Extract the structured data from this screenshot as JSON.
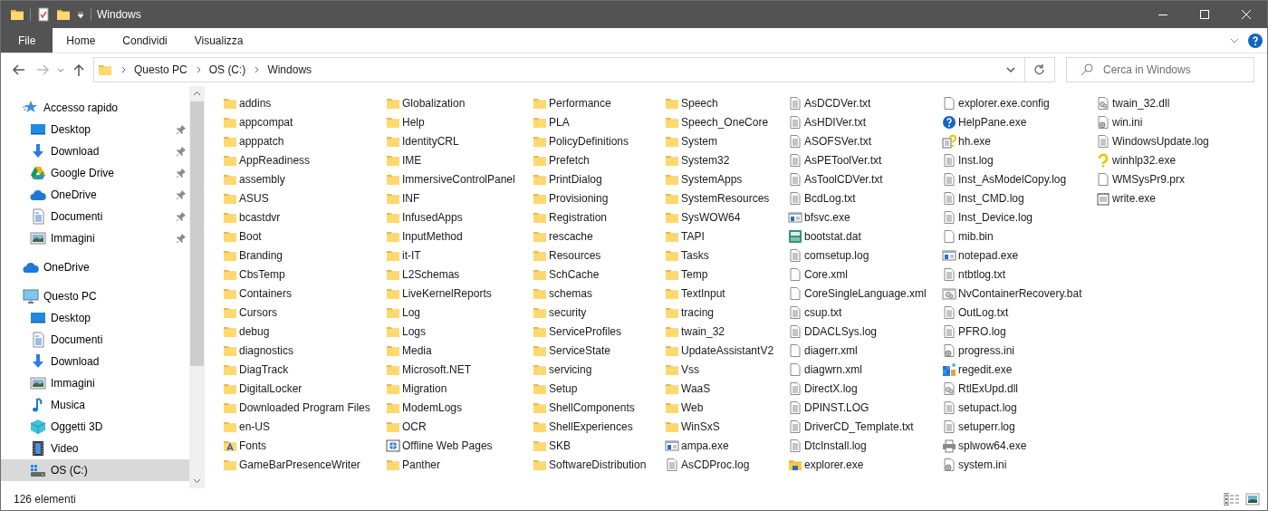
{
  "window": {
    "title": "Windows"
  },
  "ribbon": {
    "file_tab": "File",
    "tabs": [
      "Home",
      "Condividi",
      "Visualizza"
    ]
  },
  "address": {
    "path": [
      "Questo PC",
      "OS (C:)",
      "Windows"
    ]
  },
  "search": {
    "placeholder": "Cerca in Windows"
  },
  "sidebar": {
    "items": [
      {
        "label": "Accesso rapido",
        "kind": "star",
        "pinned": false,
        "selected": false,
        "children": [
          {
            "label": "Desktop",
            "kind": "desktop",
            "pinned": true,
            "selected": false
          },
          {
            "label": "Download",
            "kind": "download",
            "pinned": true,
            "selected": false
          },
          {
            "label": "Google Drive",
            "kind": "gdrive",
            "pinned": true,
            "selected": false
          },
          {
            "label": "OneDrive",
            "kind": "cloud",
            "pinned": true,
            "selected": false
          },
          {
            "label": "Documenti",
            "kind": "documents",
            "pinned": true,
            "selected": false
          },
          {
            "label": "Immagini",
            "kind": "pictures",
            "pinned": true,
            "selected": false
          }
        ]
      },
      {
        "label": "OneDrive",
        "kind": "cloud",
        "pinned": false,
        "selected": false
      },
      {
        "label": "Questo PC",
        "kind": "pc",
        "pinned": false,
        "selected": false,
        "children": [
          {
            "label": "Desktop",
            "kind": "desktop",
            "pinned": false,
            "selected": false
          },
          {
            "label": "Documenti",
            "kind": "documents",
            "pinned": false,
            "selected": false
          },
          {
            "label": "Download",
            "kind": "download",
            "pinned": false,
            "selected": false
          },
          {
            "label": "Immagini",
            "kind": "pictures",
            "pinned": false,
            "selected": false
          },
          {
            "label": "Musica",
            "kind": "music",
            "pinned": false,
            "selected": false
          },
          {
            "label": "Oggetti 3D",
            "kind": "objects3d",
            "pinned": false,
            "selected": false
          },
          {
            "label": "Video",
            "kind": "video",
            "pinned": false,
            "selected": false
          },
          {
            "label": "OS (C:)",
            "kind": "drive",
            "pinned": false,
            "selected": true
          }
        ]
      }
    ]
  },
  "files": [
    {
      "name": "addins",
      "kind": "folder"
    },
    {
      "name": "appcompat",
      "kind": "folder"
    },
    {
      "name": "apppatch",
      "kind": "folder"
    },
    {
      "name": "AppReadiness",
      "kind": "folder"
    },
    {
      "name": "assembly",
      "kind": "folder"
    },
    {
      "name": "ASUS",
      "kind": "folder"
    },
    {
      "name": "bcastdvr",
      "kind": "folder"
    },
    {
      "name": "Boot",
      "kind": "folder"
    },
    {
      "name": "Branding",
      "kind": "folder"
    },
    {
      "name": "CbsTemp",
      "kind": "folder"
    },
    {
      "name": "Containers",
      "kind": "folder"
    },
    {
      "name": "Cursors",
      "kind": "folder"
    },
    {
      "name": "debug",
      "kind": "folder"
    },
    {
      "name": "diagnostics",
      "kind": "folder"
    },
    {
      "name": "DiagTrack",
      "kind": "folder"
    },
    {
      "name": "DigitalLocker",
      "kind": "folder"
    },
    {
      "name": "Downloaded Program Files",
      "kind": "folder"
    },
    {
      "name": "en-US",
      "kind": "folder"
    },
    {
      "name": "Fonts",
      "kind": "fonts"
    },
    {
      "name": "GameBarPresenceWriter",
      "kind": "folder"
    },
    {
      "name": "Globalization",
      "kind": "folder"
    },
    {
      "name": "Help",
      "kind": "folder"
    },
    {
      "name": "IdentityCRL",
      "kind": "folder"
    },
    {
      "name": "IME",
      "kind": "folder"
    },
    {
      "name": "ImmersiveControlPanel",
      "kind": "folder"
    },
    {
      "name": "INF",
      "kind": "folder"
    },
    {
      "name": "InfusedApps",
      "kind": "folder"
    },
    {
      "name": "InputMethod",
      "kind": "folder"
    },
    {
      "name": "it-IT",
      "kind": "folder"
    },
    {
      "name": "L2Schemas",
      "kind": "folder"
    },
    {
      "name": "LiveKernelReports",
      "kind": "folder"
    },
    {
      "name": "Log",
      "kind": "folder"
    },
    {
      "name": "Logs",
      "kind": "folder"
    },
    {
      "name": "Media",
      "kind": "folder"
    },
    {
      "name": "Microsoft.NET",
      "kind": "folder"
    },
    {
      "name": "Migration",
      "kind": "folder"
    },
    {
      "name": "ModemLogs",
      "kind": "folder"
    },
    {
      "name": "OCR",
      "kind": "folder"
    },
    {
      "name": "Offline Web Pages",
      "kind": "web"
    },
    {
      "name": "Panther",
      "kind": "folder"
    },
    {
      "name": "Performance",
      "kind": "folder"
    },
    {
      "name": "PLA",
      "kind": "folder"
    },
    {
      "name": "PolicyDefinitions",
      "kind": "folder"
    },
    {
      "name": "Prefetch",
      "kind": "folder"
    },
    {
      "name": "PrintDialog",
      "kind": "folder"
    },
    {
      "name": "Provisioning",
      "kind": "folder"
    },
    {
      "name": "Registration",
      "kind": "folder"
    },
    {
      "name": "rescache",
      "kind": "folder"
    },
    {
      "name": "Resources",
      "kind": "folder"
    },
    {
      "name": "SchCache",
      "kind": "folder"
    },
    {
      "name": "schemas",
      "kind": "folder"
    },
    {
      "name": "security",
      "kind": "folder"
    },
    {
      "name": "ServiceProfiles",
      "kind": "folder"
    },
    {
      "name": "ServiceState",
      "kind": "folder"
    },
    {
      "name": "servicing",
      "kind": "folder"
    },
    {
      "name": "Setup",
      "kind": "folder"
    },
    {
      "name": "ShellComponents",
      "kind": "folder"
    },
    {
      "name": "ShellExperiences",
      "kind": "folder"
    },
    {
      "name": "SKB",
      "kind": "folder"
    },
    {
      "name": "SoftwareDistribution",
      "kind": "folder"
    },
    {
      "name": "Speech",
      "kind": "folder"
    },
    {
      "name": "Speech_OneCore",
      "kind": "folder"
    },
    {
      "name": "System",
      "kind": "folder"
    },
    {
      "name": "System32",
      "kind": "folder"
    },
    {
      "name": "SystemApps",
      "kind": "folder"
    },
    {
      "name": "SystemResources",
      "kind": "folder"
    },
    {
      "name": "SysWOW64",
      "kind": "folder"
    },
    {
      "name": "TAPI",
      "kind": "folder"
    },
    {
      "name": "Tasks",
      "kind": "folder"
    },
    {
      "name": "Temp",
      "kind": "folder"
    },
    {
      "name": "TextInput",
      "kind": "folder"
    },
    {
      "name": "tracing",
      "kind": "folder"
    },
    {
      "name": "twain_32",
      "kind": "folder"
    },
    {
      "name": "UpdateAssistantV2",
      "kind": "folder"
    },
    {
      "name": "Vss",
      "kind": "folder"
    },
    {
      "name": "WaaS",
      "kind": "folder"
    },
    {
      "name": "Web",
      "kind": "folder"
    },
    {
      "name": "WinSxS",
      "kind": "folder"
    },
    {
      "name": "ampa.exe",
      "kind": "app"
    },
    {
      "name": "AsCDProc.log",
      "kind": "doc"
    },
    {
      "name": "AsDCDVer.txt",
      "kind": "doc"
    },
    {
      "name": "AsHDIVer.txt",
      "kind": "doc"
    },
    {
      "name": "ASOFSVer.txt",
      "kind": "doc"
    },
    {
      "name": "AsPEToolVer.txt",
      "kind": "doc"
    },
    {
      "name": "AsToolCDVer.txt",
      "kind": "doc"
    },
    {
      "name": "BcdLog.txt",
      "kind": "doc"
    },
    {
      "name": "bfsvc.exe",
      "kind": "app"
    },
    {
      "name": "bootstat.dat",
      "kind": "dat"
    },
    {
      "name": "comsetup.log",
      "kind": "doc"
    },
    {
      "name": "Core.xml",
      "kind": "blank"
    },
    {
      "name": "CoreSingleLanguage.xml",
      "kind": "blank"
    },
    {
      "name": "csup.txt",
      "kind": "doc"
    },
    {
      "name": "DDACLSys.log",
      "kind": "doc"
    },
    {
      "name": "diagerr.xml",
      "kind": "blank"
    },
    {
      "name": "diagwrn.xml",
      "kind": "blank"
    },
    {
      "name": "DirectX.log",
      "kind": "doc"
    },
    {
      "name": "DPINST.LOG",
      "kind": "doc"
    },
    {
      "name": "DriverCD_Template.txt",
      "kind": "doc"
    },
    {
      "name": "DtcInstall.log",
      "kind": "doc"
    },
    {
      "name": "explorer.exe",
      "kind": "explorer"
    },
    {
      "name": "explorer.exe.config",
      "kind": "blank"
    },
    {
      "name": "HelpPane.exe",
      "kind": "help"
    },
    {
      "name": "hh.exe",
      "kind": "helpfile"
    },
    {
      "name": "Inst.log",
      "kind": "doc"
    },
    {
      "name": "Inst_AsModelCopy.log",
      "kind": "doc"
    },
    {
      "name": "Inst_CMD.log",
      "kind": "doc"
    },
    {
      "name": "Inst_Device.log",
      "kind": "doc"
    },
    {
      "name": "mib.bin",
      "kind": "blank"
    },
    {
      "name": "notepad.exe",
      "kind": "app"
    },
    {
      "name": "ntbtlog.txt",
      "kind": "doc"
    },
    {
      "name": "NvContainerRecovery.bat",
      "kind": "bat"
    },
    {
      "name": "OutLog.txt",
      "kind": "doc"
    },
    {
      "name": "PFRO.log",
      "kind": "doc"
    },
    {
      "name": "progress.ini",
      "kind": "ini"
    },
    {
      "name": "regedit.exe",
      "kind": "regedit"
    },
    {
      "name": "RtlExUpd.dll",
      "kind": "dll"
    },
    {
      "name": "setupact.log",
      "kind": "doc"
    },
    {
      "name": "setuperr.log",
      "kind": "doc"
    },
    {
      "name": "splwow64.exe",
      "kind": "printer"
    },
    {
      "name": "system.ini",
      "kind": "ini"
    },
    {
      "name": "twain_32.dll",
      "kind": "dll"
    },
    {
      "name": "win.ini",
      "kind": "ini"
    },
    {
      "name": "WindowsUpdate.log",
      "kind": "doc"
    },
    {
      "name": "winhlp32.exe",
      "kind": "winhlp"
    },
    {
      "name": "WMSysPr9.prx",
      "kind": "blank"
    },
    {
      "name": "write.exe",
      "kind": "write"
    }
  ],
  "status_bar": {
    "count": "126 elementi"
  }
}
